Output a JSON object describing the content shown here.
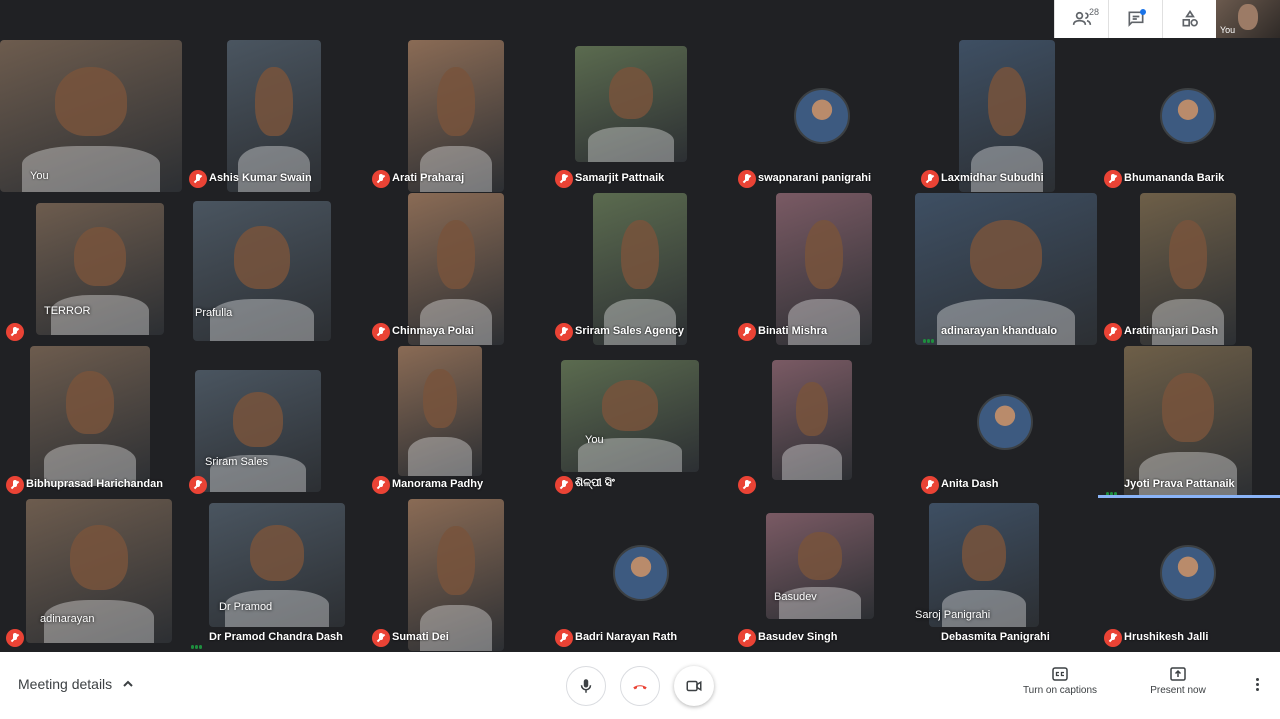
{
  "top_controls": {
    "participant_count": "28",
    "self_label": "You"
  },
  "tiles": [
    {
      "name": "You",
      "style": "video",
      "muted": false
    },
    {
      "name": "Ashis Kumar Swain",
      "style": "video",
      "muted": true
    },
    {
      "name": "Arati Praharaj",
      "style": "video",
      "muted": true
    },
    {
      "name": "Samarjit Pattnaik",
      "style": "video",
      "muted": true
    },
    {
      "name": "swapnarani panigrahi",
      "style": "avatar",
      "muted": true
    },
    {
      "name": "Laxmidhar Subudhi",
      "style": "video",
      "muted": true
    },
    {
      "name": "Bhumananda Barik",
      "style": "avatar",
      "muted": true
    },
    {
      "name": "",
      "inline": "TERROR",
      "style": "video",
      "muted": true
    },
    {
      "name": "",
      "inline": "Prafulla",
      "style": "video",
      "muted": false
    },
    {
      "name": "Chinmaya Polai",
      "style": "video",
      "muted": true
    },
    {
      "name": "Sriram Sales Agency",
      "style": "video",
      "muted": true
    },
    {
      "name": "Binati Mishra",
      "style": "video",
      "muted": true
    },
    {
      "name": "adinarayan khandualo",
      "style": "video",
      "muted": false,
      "speaking": true
    },
    {
      "name": "Aratimanjari Dash",
      "style": "video",
      "muted": true
    },
    {
      "name": "Bibhuprasad Harichandan",
      "style": "video",
      "muted": true
    },
    {
      "name": "",
      "inline": "Sriram Sales",
      "style": "video",
      "muted": true
    },
    {
      "name": "Manorama Padhy",
      "style": "video",
      "muted": true
    },
    {
      "name": "ଶିଳ୍ପୀ ସିଂ",
      "inline": "You",
      "style": "video",
      "muted": true
    },
    {
      "name": "",
      "style": "video",
      "muted": true
    },
    {
      "name": "Anita Dash",
      "style": "avatar",
      "muted": true
    },
    {
      "name": "Jyoti Prava Pattanaik",
      "style": "video",
      "muted": false,
      "speaking": true,
      "active": true
    },
    {
      "name": "",
      "inline": "adinarayan",
      "style": "video",
      "muted": true
    },
    {
      "name": "Dr Pramod Chandra Dash",
      "inline": "Dr Pramod",
      "style": "video",
      "muted": false,
      "speaking": true
    },
    {
      "name": "Sumati Dei",
      "style": "video",
      "muted": true
    },
    {
      "name": "Badri Narayan Rath",
      "style": "avatar",
      "muted": true
    },
    {
      "name": "Basudev Singh",
      "inline": "Basudev",
      "style": "video",
      "muted": true
    },
    {
      "name": "Debasmita Panigrahi",
      "inline": "Saroj Panigrahi",
      "style": "video",
      "muted": false
    },
    {
      "name": "Hrushikesh Jalli",
      "style": "avatar",
      "muted": true
    }
  ],
  "bottom_bar": {
    "meeting_details_label": "Meeting details",
    "captions_label": "Turn on captions",
    "present_label": "Present now"
  }
}
